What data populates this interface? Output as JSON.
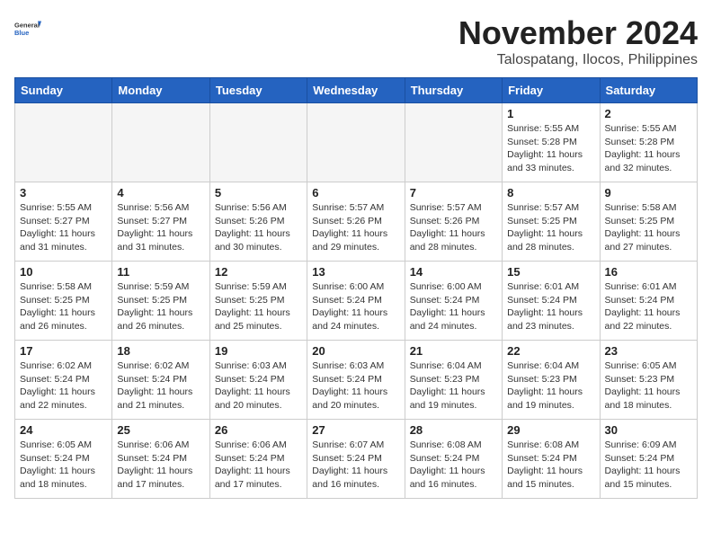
{
  "logo": {
    "general": "General",
    "blue": "Blue"
  },
  "title": "November 2024",
  "location": "Talospatang, Ilocos, Philippines",
  "days_of_week": [
    "Sunday",
    "Monday",
    "Tuesday",
    "Wednesday",
    "Thursday",
    "Friday",
    "Saturday"
  ],
  "weeks": [
    [
      {
        "day": "",
        "info": ""
      },
      {
        "day": "",
        "info": ""
      },
      {
        "day": "",
        "info": ""
      },
      {
        "day": "",
        "info": ""
      },
      {
        "day": "",
        "info": ""
      },
      {
        "day": "1",
        "info": "Sunrise: 5:55 AM\nSunset: 5:28 PM\nDaylight: 11 hours and 33 minutes."
      },
      {
        "day": "2",
        "info": "Sunrise: 5:55 AM\nSunset: 5:28 PM\nDaylight: 11 hours and 32 minutes."
      }
    ],
    [
      {
        "day": "3",
        "info": "Sunrise: 5:55 AM\nSunset: 5:27 PM\nDaylight: 11 hours and 31 minutes."
      },
      {
        "day": "4",
        "info": "Sunrise: 5:56 AM\nSunset: 5:27 PM\nDaylight: 11 hours and 31 minutes."
      },
      {
        "day": "5",
        "info": "Sunrise: 5:56 AM\nSunset: 5:26 PM\nDaylight: 11 hours and 30 minutes."
      },
      {
        "day": "6",
        "info": "Sunrise: 5:57 AM\nSunset: 5:26 PM\nDaylight: 11 hours and 29 minutes."
      },
      {
        "day": "7",
        "info": "Sunrise: 5:57 AM\nSunset: 5:26 PM\nDaylight: 11 hours and 28 minutes."
      },
      {
        "day": "8",
        "info": "Sunrise: 5:57 AM\nSunset: 5:25 PM\nDaylight: 11 hours and 28 minutes."
      },
      {
        "day": "9",
        "info": "Sunrise: 5:58 AM\nSunset: 5:25 PM\nDaylight: 11 hours and 27 minutes."
      }
    ],
    [
      {
        "day": "10",
        "info": "Sunrise: 5:58 AM\nSunset: 5:25 PM\nDaylight: 11 hours and 26 minutes."
      },
      {
        "day": "11",
        "info": "Sunrise: 5:59 AM\nSunset: 5:25 PM\nDaylight: 11 hours and 26 minutes."
      },
      {
        "day": "12",
        "info": "Sunrise: 5:59 AM\nSunset: 5:25 PM\nDaylight: 11 hours and 25 minutes."
      },
      {
        "day": "13",
        "info": "Sunrise: 6:00 AM\nSunset: 5:24 PM\nDaylight: 11 hours and 24 minutes."
      },
      {
        "day": "14",
        "info": "Sunrise: 6:00 AM\nSunset: 5:24 PM\nDaylight: 11 hours and 24 minutes."
      },
      {
        "day": "15",
        "info": "Sunrise: 6:01 AM\nSunset: 5:24 PM\nDaylight: 11 hours and 23 minutes."
      },
      {
        "day": "16",
        "info": "Sunrise: 6:01 AM\nSunset: 5:24 PM\nDaylight: 11 hours and 22 minutes."
      }
    ],
    [
      {
        "day": "17",
        "info": "Sunrise: 6:02 AM\nSunset: 5:24 PM\nDaylight: 11 hours and 22 minutes."
      },
      {
        "day": "18",
        "info": "Sunrise: 6:02 AM\nSunset: 5:24 PM\nDaylight: 11 hours and 21 minutes."
      },
      {
        "day": "19",
        "info": "Sunrise: 6:03 AM\nSunset: 5:24 PM\nDaylight: 11 hours and 20 minutes."
      },
      {
        "day": "20",
        "info": "Sunrise: 6:03 AM\nSunset: 5:24 PM\nDaylight: 11 hours and 20 minutes."
      },
      {
        "day": "21",
        "info": "Sunrise: 6:04 AM\nSunset: 5:23 PM\nDaylight: 11 hours and 19 minutes."
      },
      {
        "day": "22",
        "info": "Sunrise: 6:04 AM\nSunset: 5:23 PM\nDaylight: 11 hours and 19 minutes."
      },
      {
        "day": "23",
        "info": "Sunrise: 6:05 AM\nSunset: 5:23 PM\nDaylight: 11 hours and 18 minutes."
      }
    ],
    [
      {
        "day": "24",
        "info": "Sunrise: 6:05 AM\nSunset: 5:24 PM\nDaylight: 11 hours and 18 minutes."
      },
      {
        "day": "25",
        "info": "Sunrise: 6:06 AM\nSunset: 5:24 PM\nDaylight: 11 hours and 17 minutes."
      },
      {
        "day": "26",
        "info": "Sunrise: 6:06 AM\nSunset: 5:24 PM\nDaylight: 11 hours and 17 minutes."
      },
      {
        "day": "27",
        "info": "Sunrise: 6:07 AM\nSunset: 5:24 PM\nDaylight: 11 hours and 16 minutes."
      },
      {
        "day": "28",
        "info": "Sunrise: 6:08 AM\nSunset: 5:24 PM\nDaylight: 11 hours and 16 minutes."
      },
      {
        "day": "29",
        "info": "Sunrise: 6:08 AM\nSunset: 5:24 PM\nDaylight: 11 hours and 15 minutes."
      },
      {
        "day": "30",
        "info": "Sunrise: 6:09 AM\nSunset: 5:24 PM\nDaylight: 11 hours and 15 minutes."
      }
    ]
  ]
}
